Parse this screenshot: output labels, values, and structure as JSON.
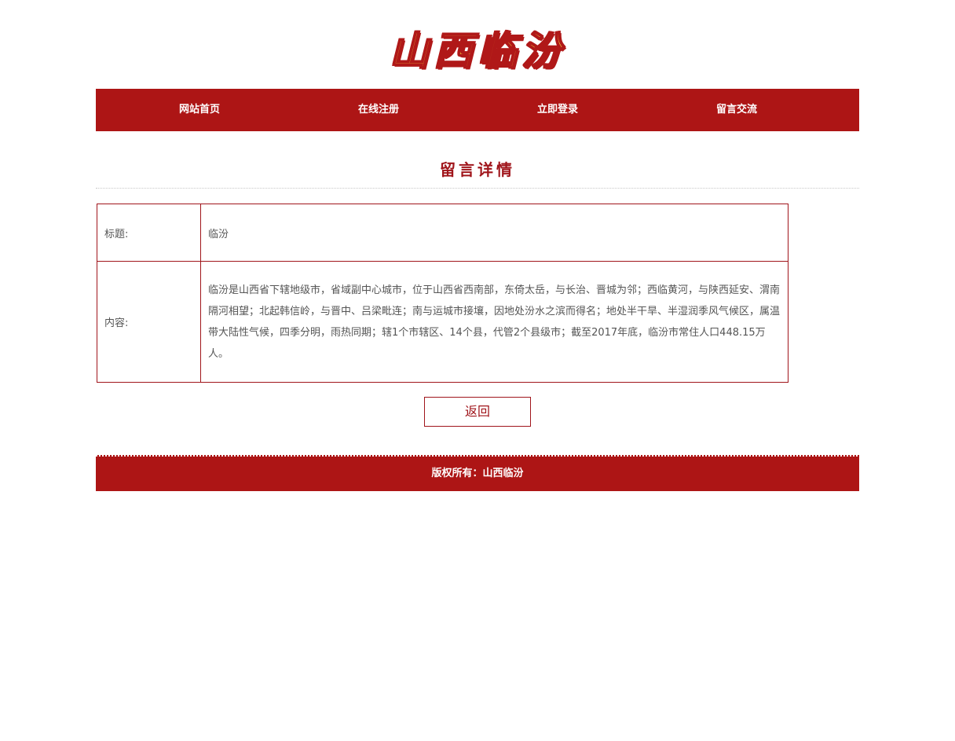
{
  "site": {
    "logo_text": "山西临汾"
  },
  "nav": {
    "items": [
      {
        "label": "网站首页"
      },
      {
        "label": "在线注册"
      },
      {
        "label": "立即登录"
      },
      {
        "label": "留言交流"
      }
    ]
  },
  "page": {
    "title": "留言详情"
  },
  "detail": {
    "title_label": "标题:",
    "title_value": "临汾",
    "content_label": "内容:",
    "content_value": "临汾是山西省下辖地级市，省域副中心城市，位于山西省西南部，东倚太岳，与长治、晋城为邻；西临黄河，与陕西延安、渭南隔河相望；北起韩信岭，与晋中、吕梁毗连；南与运城市接壤，因地处汾水之滨而得名；地处半干旱、半湿润季风气候区，属温带大陆性气候，四季分明，雨热同期；辖1个市辖区、14个县，代管2个县级市；截至2017年底，临汾市常住人口448.15万人。"
  },
  "actions": {
    "back_label": "返回"
  },
  "footer": {
    "copyright": "版权所有：山西临汾"
  },
  "colors": {
    "brand_red": "#ad1515",
    "logo_yellow": "#f4d33a"
  }
}
